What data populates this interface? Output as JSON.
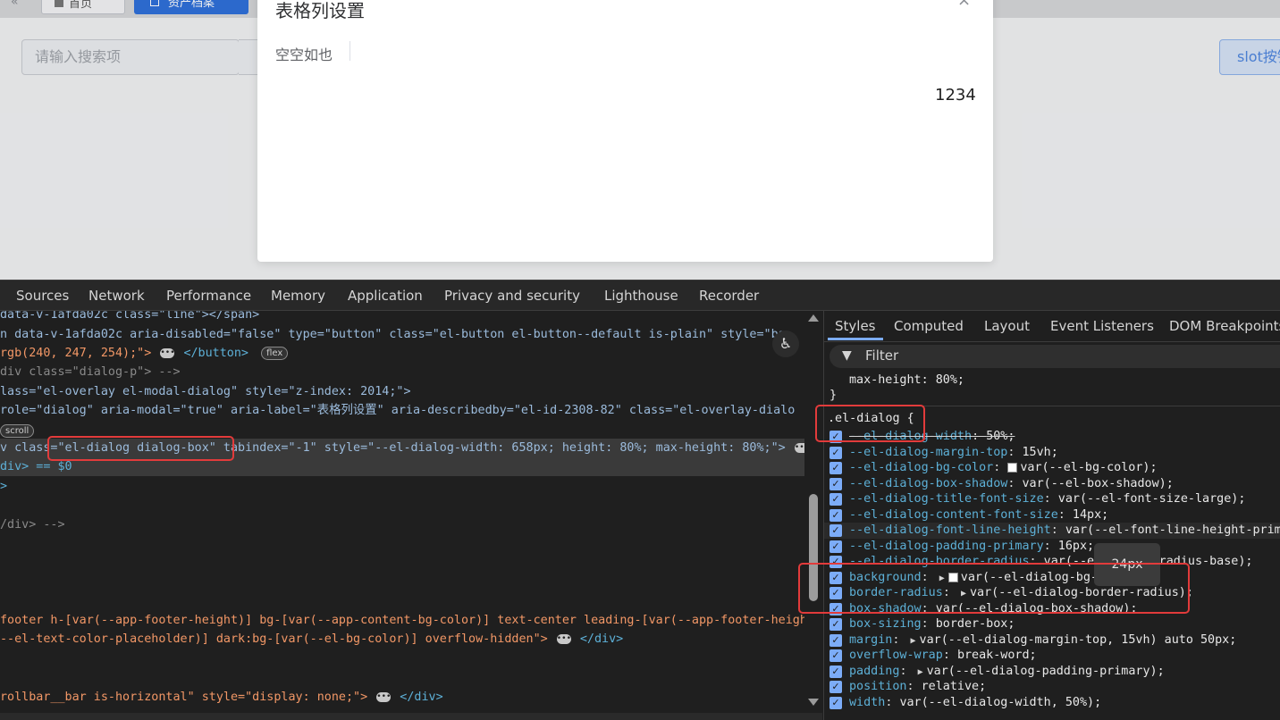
{
  "page": {
    "back_icon": "«",
    "tab_home": "首页",
    "tab_active": "资产档案",
    "search_placeholder": "请输入搜索项",
    "slot_button": "slot按钮"
  },
  "dialog": {
    "title": "表格列设置",
    "close_icon": "×",
    "empty_text": "空空如也",
    "number_text": "1234"
  },
  "devtools": {
    "tabs": [
      "Sources",
      "Network",
      "Performance",
      "Memory",
      "Application",
      "Privacy and security",
      "Lighthouse",
      "Recorder"
    ],
    "accessibility_icon": "♿",
    "element_lines": [
      "data-v-1afda02c class=\"line\"></span>",
      "n data-v-1afda02c aria-disabled=\"false\" type=\"button\" class=\"el-button el-button--default is-plain\" style=\"ba",
      " rgb(240, 247, 254);\">",
      "</button>",
      "flex",
      "div class=\"dialog-p\"> -->",
      "lass=\"el-overlay el-modal-dialog\" style=\"z-index: 2014;\">",
      " role=\"dialog\" aria-modal=\"true\" aria-label=\"表格列设置\" aria-describedby=\"el-id-2308-82\" class=\"el-overlay-dialo",
      "scroll",
      "v class=\"el-dialog dialog-box\" tabindex=\"-1\" style=\"--el-dialog-width: 658px; height: 80%; max-height: 80%;\">",
      "div> == $0",
      ">",
      "/div> -->",
      "footer h-[var(--app-footer-height)] bg-[var(--app-content-bg-color)] text-center leading-[var(--app-footer-heigh",
      "--el-text-color-placeholder)] dark:bg-[var(--el-bg-color)] overflow-hidden\">",
      "</div>",
      "rollbar__bar is-horizontal\" style=\"display: none;\">",
      "</div>"
    ],
    "styles_tabs": [
      "Styles",
      "Computed",
      "Layout",
      "Event Listeners",
      "DOM Breakpoints"
    ],
    "filter_label": "Filter",
    "prev_rule_line": "max-height: 80%;",
    "prev_rule_close": "}",
    "rule_selector": ".el-dialog {",
    "tooltip": "24px",
    "properties": [
      {
        "name": "--el-dialog-width",
        "value": "50%;"
      },
      {
        "name": "--el-dialog-margin-top",
        "value": "15vh;"
      },
      {
        "name": "--el-dialog-bg-color",
        "value": "var(--el-bg-color);"
      },
      {
        "name": "--el-dialog-box-shadow",
        "value": "var(--el-box-shadow);"
      },
      {
        "name": "--el-dialog-title-font-size",
        "value": "var(--el-font-size-large);"
      },
      {
        "name": "--el-dialog-content-font-size",
        "value": "14px;"
      },
      {
        "name": "--el-dialog-font-line-height",
        "value": "var(--el-font-line-height-prima"
      },
      {
        "name": "--el-dialog-padding-primary",
        "value": "16px;"
      },
      {
        "name": "--el-dialog-border-radius",
        "value": "var(--el-border-radius-base);"
      },
      {
        "name": "background",
        "value": "var(--el-dialog-bg-color);"
      },
      {
        "name": "border-radius",
        "value": "var(--el-dialog-border-radius);"
      },
      {
        "name": "box-shadow",
        "value": "var(--el-dialog-box-shadow);"
      },
      {
        "name": "box-sizing",
        "value": "border-box;"
      },
      {
        "name": "margin",
        "value": "var(--el-dialog-margin-top, 15vh) auto 50px;"
      },
      {
        "name": "overflow-wrap",
        "value": "break-word;"
      },
      {
        "name": "padding",
        "value": "var(--el-dialog-padding-primary);"
      },
      {
        "name": "position",
        "value": "relative;"
      },
      {
        "name": "width",
        "value": "var(--el-dialog-width, 50%);"
      }
    ]
  },
  "colors": {
    "accent": "#2d6fdb",
    "highlight_box": "#e23b3b",
    "checkbox": "#7cacf8"
  }
}
